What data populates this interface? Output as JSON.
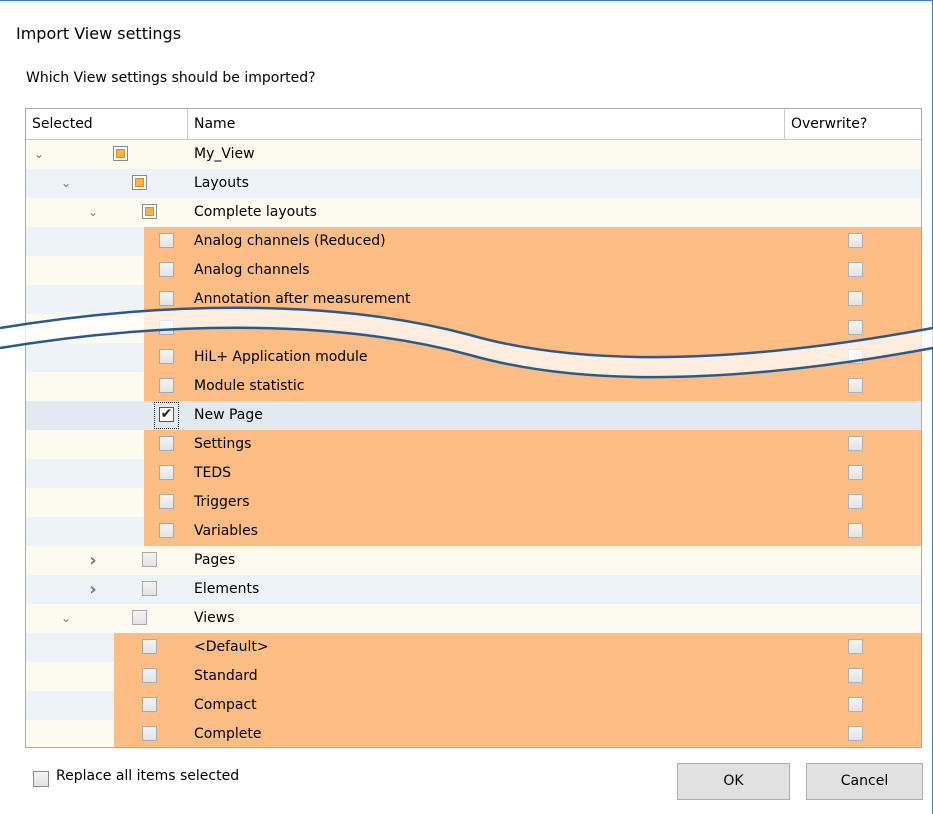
{
  "dialog": {
    "title": "Import View settings",
    "prompt": "Which View settings should be imported?"
  },
  "tree": {
    "columns": {
      "selected": "Selected",
      "name": "Name",
      "overwrite": "Overwrite?"
    },
    "rows": [
      {
        "label": "My_View",
        "level": 0,
        "expand": "collapse",
        "state": "partial",
        "highlight": false,
        "overwrite": false
      },
      {
        "label": "Layouts",
        "level": 1,
        "expand": "collapse",
        "state": "partial",
        "highlight": false,
        "overwrite": false
      },
      {
        "label": "Complete layouts",
        "level": 2,
        "expand": "collapse",
        "state": "partial",
        "highlight": false,
        "overwrite": false
      },
      {
        "label": "Analog channels (Reduced)",
        "level": 3,
        "expand": "none",
        "state": "unchecked",
        "highlight": true,
        "overwrite": true
      },
      {
        "label": "Analog channels",
        "level": 3,
        "expand": "none",
        "state": "unchecked",
        "highlight": true,
        "overwrite": true
      },
      {
        "label": "Annotation after measurement",
        "level": 3,
        "expand": "none",
        "state": "unchecked",
        "highlight": true,
        "overwrite": true
      },
      {
        "label": "",
        "level": 3,
        "expand": "none",
        "state": "unchecked",
        "highlight": true,
        "overwrite": true
      },
      {
        "label": "HiL+ Application module",
        "level": 3,
        "expand": "none",
        "state": "unchecked",
        "highlight": true,
        "overwrite": true
      },
      {
        "label": "Module statistic",
        "level": 3,
        "expand": "none",
        "state": "unchecked",
        "highlight": true,
        "overwrite": true
      },
      {
        "label": "New Page",
        "level": 3,
        "expand": "none",
        "state": "checked",
        "highlight": false,
        "overwrite": false,
        "selected": true
      },
      {
        "label": "Settings",
        "level": 3,
        "expand": "none",
        "state": "unchecked",
        "highlight": true,
        "overwrite": true
      },
      {
        "label": "TEDS",
        "level": 3,
        "expand": "none",
        "state": "unchecked",
        "highlight": true,
        "overwrite": true
      },
      {
        "label": "Triggers",
        "level": 3,
        "expand": "none",
        "state": "unchecked",
        "highlight": true,
        "overwrite": true
      },
      {
        "label": "Variables",
        "level": 3,
        "expand": "none",
        "state": "unchecked",
        "highlight": true,
        "overwrite": true
      },
      {
        "label": "Pages",
        "level": 2,
        "expand": "expand",
        "state": "unchecked",
        "highlight": false,
        "overwrite": false
      },
      {
        "label": "Elements",
        "level": 2,
        "expand": "expand",
        "state": "unchecked",
        "highlight": false,
        "overwrite": false
      },
      {
        "label": "Views",
        "level": 1,
        "expand": "collapse",
        "state": "unchecked",
        "highlight": false,
        "overwrite": false
      },
      {
        "label": "<Default>",
        "level": 2,
        "expand": "none",
        "state": "unchecked",
        "highlight": true,
        "overwrite": true
      },
      {
        "label": "Standard",
        "level": 2,
        "expand": "none",
        "state": "unchecked",
        "highlight": true,
        "overwrite": true
      },
      {
        "label": "Compact",
        "level": 2,
        "expand": "none",
        "state": "unchecked",
        "highlight": true,
        "overwrite": true
      },
      {
        "label": "Complete",
        "level": 2,
        "expand": "none",
        "state": "unchecked",
        "highlight": true,
        "overwrite": true
      }
    ]
  },
  "footer": {
    "replace_label": "Replace all items selected",
    "ok_label": "OK",
    "cancel_label": "Cancel"
  },
  "icons": {
    "collapse": "chevron-down-icon",
    "expand": "chevron-right-icon",
    "check": "check-icon"
  },
  "colors": {
    "highlight": "#fdbd85",
    "partial_fill": "#f8b44a",
    "row_odd": "#fdfaf0",
    "row_even": "#eef3f9",
    "row_selected": "#e2e9f3",
    "window_border": "#3a7fc6",
    "wave_stroke": "#2a5a8c"
  }
}
